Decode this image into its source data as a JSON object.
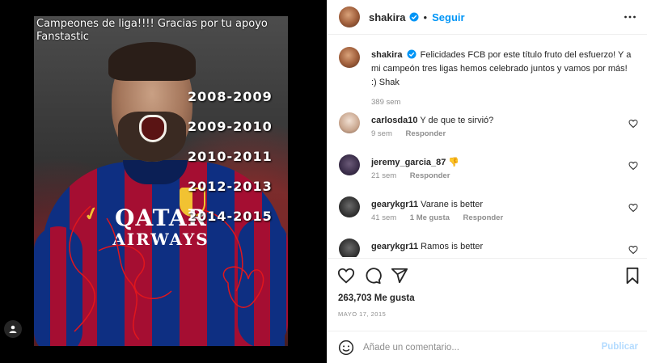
{
  "media": {
    "caption_top": "Campeones de liga!!!! Gracias por tu apoyo Fanstastic",
    "seasons": [
      "2008-2009",
      "2009-2010",
      "2010-2011",
      "2012-2013",
      "2014-2015"
    ],
    "sponsor_line1": "QATAR",
    "sponsor_line2": "AIRWAYS"
  },
  "header": {
    "username": "shakira",
    "separator": "•",
    "follow_label": "Seguir"
  },
  "post_caption": {
    "username": "shakira",
    "text": "Felicidades FCB por este título fruto del esfuerzo! Y a mi campeón tres ligas hemos celebrado juntos y vamos por más! :) Shak",
    "time": "389 sem"
  },
  "comments": [
    {
      "username": "carlosda10",
      "text": "Y de que te sirvió?",
      "time": "9 sem",
      "likes": "",
      "reply": "Responder"
    },
    {
      "username": "jeremy_garcia_87",
      "text": "👎",
      "time": "21 sem",
      "likes": "",
      "reply": "Responder"
    },
    {
      "username": "gearykgr11",
      "text": "Varane is better",
      "time": "41 sem",
      "likes": "1 Me gusta",
      "reply": "Responder"
    },
    {
      "username": "gearykgr11",
      "text": "Ramos is better",
      "time": "",
      "likes": "",
      "reply": ""
    }
  ],
  "stats": {
    "likes": "263,703 Me gusta",
    "date": "MAYO 17, 2015"
  },
  "comment_box": {
    "placeholder": "Añade un comentario...",
    "post_label": "Publicar"
  },
  "colors": {
    "accent": "#0095f6",
    "post_disabled": "#b3dbff",
    "muted": "#8e8e8e"
  },
  "icons": [
    "verified-icon",
    "more-icon",
    "heart-icon",
    "comment-icon",
    "share-icon",
    "bookmark-icon",
    "emoji-icon",
    "user-tag-icon"
  ]
}
